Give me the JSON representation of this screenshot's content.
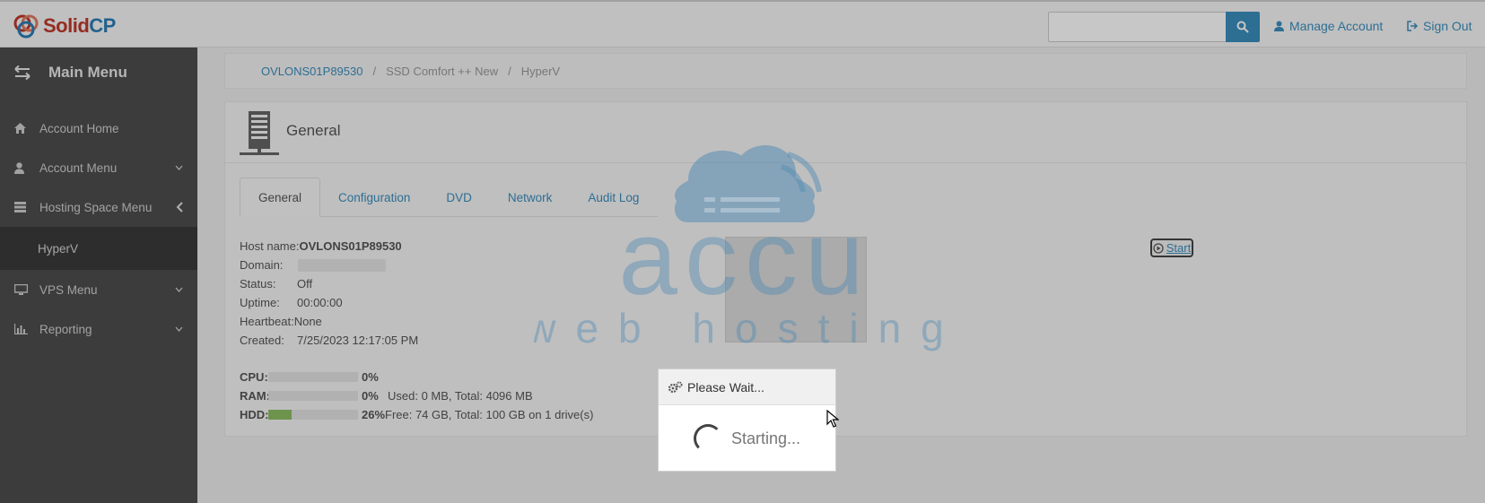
{
  "brand": {
    "name_part1": "Solid",
    "name_part2": "CP"
  },
  "topbar": {
    "search_placeholder": "",
    "manage_account": "Manage Account",
    "sign_out": "Sign Out"
  },
  "sidebar": {
    "header": "Main Menu",
    "items": [
      {
        "label": "Account Home",
        "icon": "home-icon"
      },
      {
        "label": "Account Menu",
        "icon": "user-icon"
      },
      {
        "label": "Hosting Space Menu",
        "icon": "server-stack-icon"
      },
      {
        "label": "HyperV"
      },
      {
        "label": "VPS Menu",
        "icon": "monitor-icon"
      },
      {
        "label": "Reporting",
        "icon": "bar-chart-icon"
      }
    ]
  },
  "breadcrumb": {
    "server": "OVLONS01P89530",
    "plan": "SSD Comfort ++ New",
    "section": "HyperV"
  },
  "panel": {
    "title": "General",
    "tabs": [
      "General",
      "Configuration",
      "DVD",
      "Network",
      "Audit Log"
    ],
    "info": {
      "host_label": "Host name:",
      "host_value": "OVLONS01P89530",
      "domain_label": "Domain:",
      "status_label": "Status:",
      "status_value": "Off",
      "uptime_label": "Uptime:",
      "uptime_value": "00:00:00",
      "heartbeat_label": "Heartbeat:",
      "heartbeat_value": "None",
      "created_label": "Created:",
      "created_value": "7/25/2023 12:17:05 PM"
    },
    "usage": {
      "cpu_label": "CPU:",
      "cpu_pct": "0%",
      "cpu_fraction": 0,
      "ram_label": "RAM:",
      "ram_pct": "0%",
      "ram_fraction": 0,
      "ram_detail": "Used: 0 MB, Total: 4096 MB",
      "hdd_label": "HDD:",
      "hdd_pct": "26%",
      "hdd_fraction": 0.26,
      "hdd_detail": "Free: 74 GB, Total: 100 GB on 1 drive(s)"
    },
    "start_button": "Start"
  },
  "dialog": {
    "title": "Please Wait...",
    "message": "Starting..."
  },
  "watermark": {
    "line1": "accu",
    "line2": "web hosting"
  },
  "colors": {
    "accent": "#3a8ebd",
    "sidebar_bg": "#4d4d4d",
    "brand_red": "#c0392b",
    "hdd_fill": "#8dbd63"
  }
}
